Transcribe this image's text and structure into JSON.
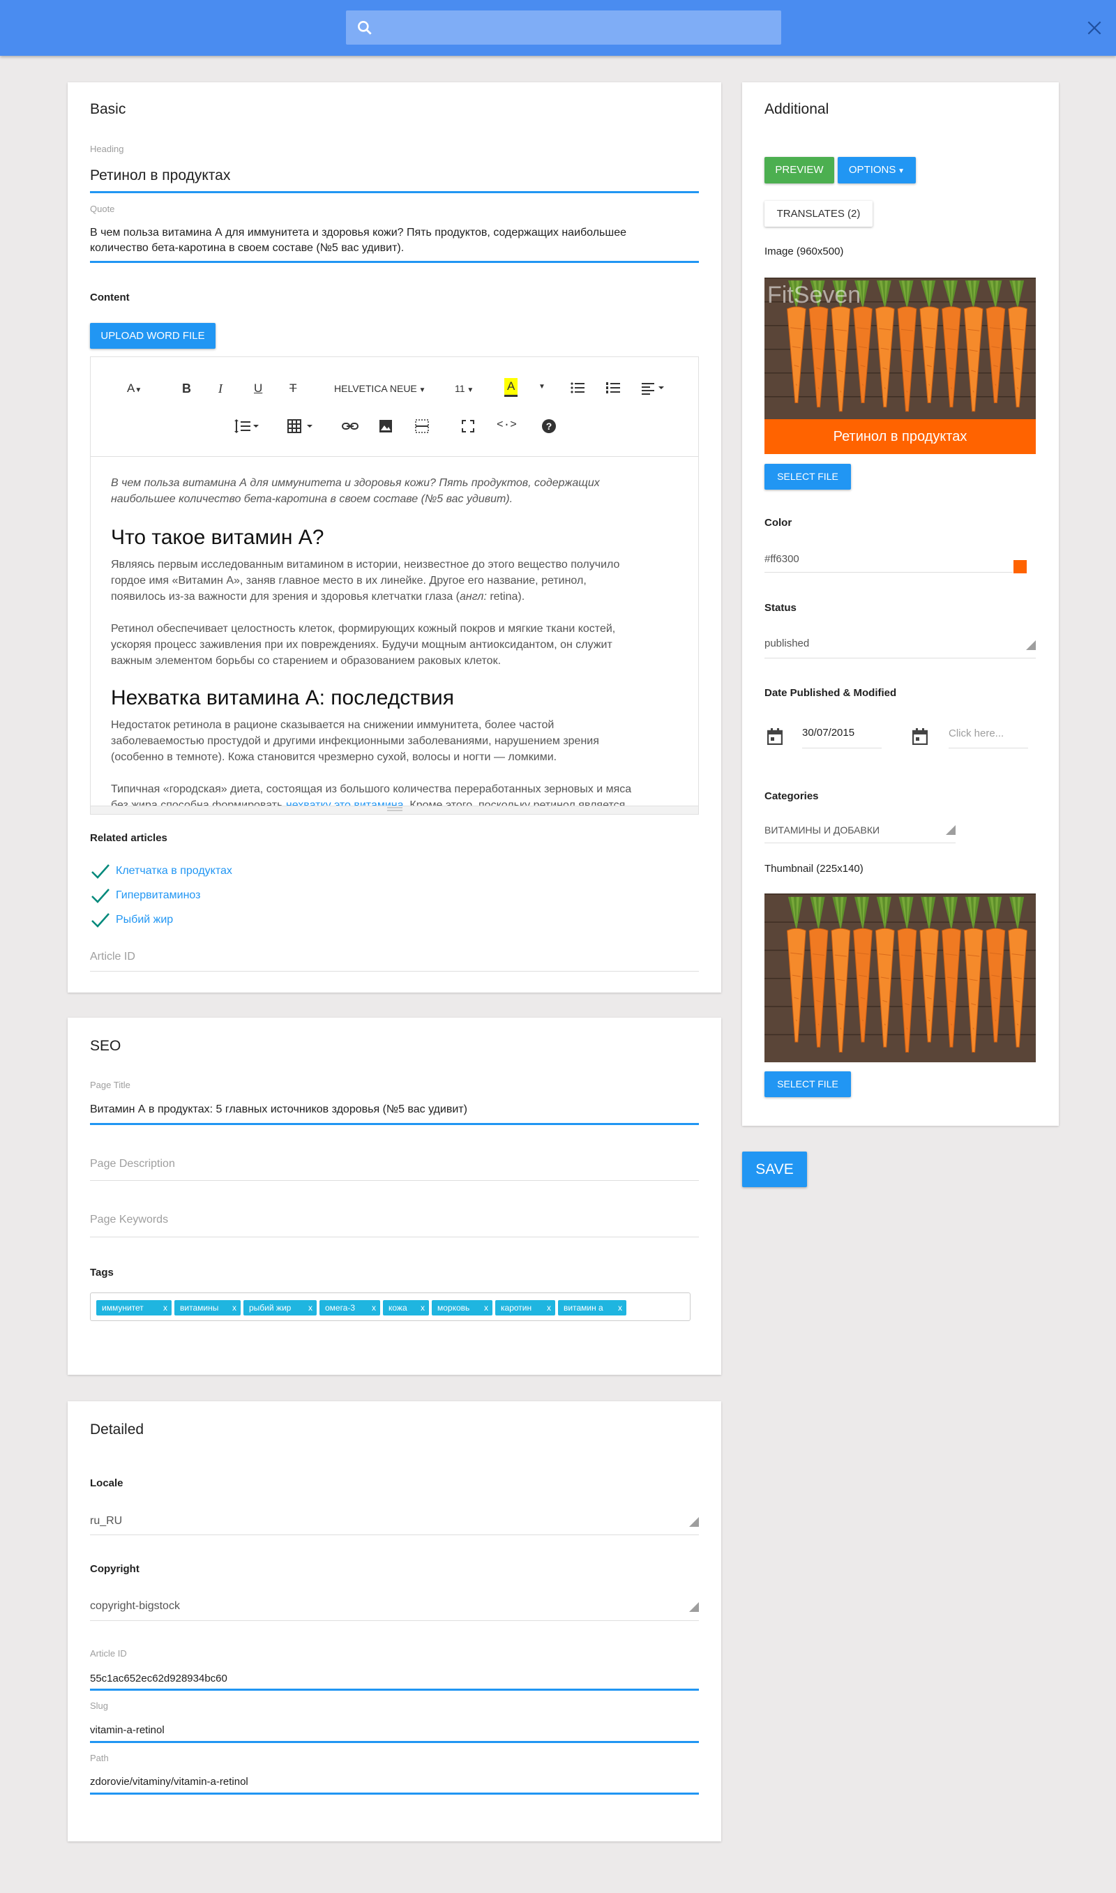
{
  "basic": {
    "title": "Basic",
    "heading_label": "Heading",
    "heading_value": "Ретинол в продуктах",
    "quote_label": "Quote",
    "quote_line1": "В чем польза витамина А для иммунитета и здоровья кожи? Пять продуктов, содержащих наибольшее",
    "quote_line2": "количество бета-каротина в своем составе (№5 вас удивит).",
    "content_label": "Content",
    "upload_label": "UPLOAD WORD FILE",
    "toolbar": {
      "font_family": "HELVETICA NEUE",
      "font_size": "11"
    },
    "editor": {
      "intro_line1": "В чем польза витамина А для иммунитета и здоровья кожи? Пять продуктов, содержащих",
      "intro_line2": "наибольшее количество бета-каротина в своем составе (№5 вас удивит).",
      "h1": "Что такое витамин А?",
      "p1_line1": "Являясь первым исследованным витамином в истории, неизвестное до этого вещество получило",
      "p1_line2": "гордое имя «Витамин А», заняв главное место в их линейке. Другое его название, ретинол,",
      "p1_line3_a": "появилось из-за важности для зрения и здоровья клетчатки глаза (",
      "p1_line3_b": "англ:",
      "p1_line3_c": " retina).",
      "p2_line1": "Ретинол обеспечивает целостность клеток, формирующих кожный покров и мягкие ткани костей,",
      "p2_line2": "ускоряя процесс заживления при их повреждениях. Будучи мощным антиоксидантом, он служит",
      "p2_line3": "важным элементом борьбы со старением и образованием раковых клеток.",
      "h2": "Нехватка витамина А: последствия",
      "p3_line1": "Недостаток ретинола в рационе сказывается на снижении иммунитета, более частой",
      "p3_line2": "заболеваемостью простудой и другими инфекционными заболеваниями, нарушением зрения",
      "p3_line3": "(особенно в темноте). Кожа становится чрезмерно сухой, волосы и ногти — ломкими.",
      "p4_line1": "Типичная «городская» диета, состоящая из большого количества переработанных зерновых и мяса",
      "p4_line2_a": "без жира способна формировать ",
      "p4_line2_link": "нехватку это витамина",
      "p4_line2_c": ". Кроме этого, поскольку ретинол является"
    },
    "related_label": "Related articles",
    "related": [
      "Клетчатка в продуктах",
      "Гипервитаминоз",
      "Рыбий жир"
    ],
    "article_id_placeholder": "Article ID"
  },
  "seo": {
    "title": "SEO",
    "page_title_label": "Page Title",
    "page_title_value": "Витамин А в продуктах: 5 главных источников здоровья (№5 вас удивит)",
    "page_description_placeholder": "Page Description",
    "page_keywords_placeholder": "Page Keywords",
    "tags_label": "Tags",
    "tags": [
      "иммунитет",
      "витамины",
      "рыбий жир",
      "омега-3",
      "кожа",
      "морковь",
      "каротин",
      "витамин а"
    ],
    "tag_remove": "x"
  },
  "detailed": {
    "title": "Detailed",
    "locale_label": "Locale",
    "locale_value": "ru_RU",
    "copyright_label": "Copyright",
    "copyright_value": "copyright-bigstock",
    "article_id_label": "Article ID",
    "article_id_value": "55c1ac652ec62d928934bc60",
    "slug_label": "Slug",
    "slug_value": "vitamin-a-retinol",
    "path_label": "Path",
    "path_value": "zdorovie/vitaminy/vitamin-a-retinol"
  },
  "additional": {
    "title": "Additional",
    "preview_label": "PREVIEW",
    "options_label": "OPTIONS",
    "translates_label": "TRANSLATES (2)",
    "image_label": "Image (960x500)",
    "image_watermark": "FitSeven",
    "image_caption": "Ретинол в продуктах",
    "select_file_label": "SELECT FILE",
    "color_label": "Color",
    "color_value": "#ff6300",
    "status_label": "Status",
    "status_value": "published",
    "date_label": "Date Published & Modified",
    "date_published": "30/07/2015",
    "date_modified_placeholder": "Click here...",
    "categories_label": "Categories",
    "categories_value": "ВИТАМИНЫ И ДОБАВКИ",
    "thumbnail_label": "Thumbnail (225x140)",
    "thumb_select_file_label": "SELECT FILE"
  },
  "save_label": "SAVE",
  "colors": {
    "topbar": "#4a8cf0",
    "accent": "#2196f3",
    "preview": "#4caf50",
    "brand_orange": "#ff6300",
    "tag": "#1fb5e0"
  }
}
